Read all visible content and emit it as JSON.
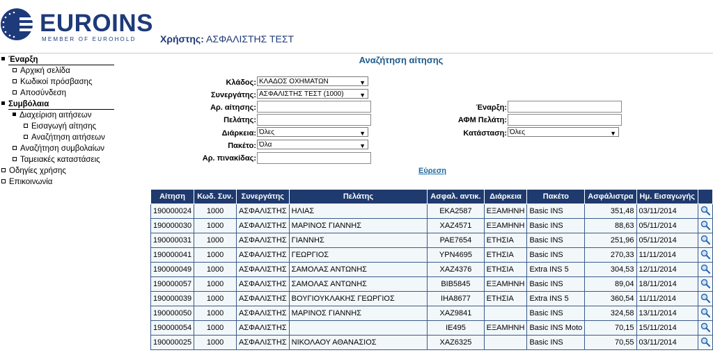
{
  "header": {
    "brand": "EUROINS",
    "brand_sub": "MEMBER OF EUROHOLD",
    "user_label": "Χρήστης:",
    "user_name": "ΑΣΦΑΛΙΣΤΗΣ ΤΕΣΤ"
  },
  "sidebar": {
    "items": [
      {
        "label": "Έναρξη"
      },
      {
        "label": "Αρχική σελίδα"
      },
      {
        "label": "Κωδικοί πρόσβασης"
      },
      {
        "label": "Αποσύνδεση"
      },
      {
        "label": "Συμβόλαια"
      },
      {
        "label": "Διαχείριση αιτήσεων"
      },
      {
        "label": "Εισαγωγή αίτησης"
      },
      {
        "label": "Αναζήτηση αιτήσεων"
      },
      {
        "label": "Αναζήτηση συμβολαίων"
      },
      {
        "label": "Ταμειακές καταστάσεις"
      },
      {
        "label": "Οδηγίες χρήσης"
      },
      {
        "label": "Επικοινωνία"
      }
    ]
  },
  "main": {
    "title": "Αναζήτηση αίτησης",
    "form": {
      "branch_label": "Κλάδος:",
      "branch_value": "ΚΛΑΔΟΣ ΟΧΗΜΑΤΩΝ",
      "partner_label": "Συνεργάτης:",
      "partner_value": "ΑΣΦΑΛΙΣΤΗΣ ΤΕΣΤ (1000)",
      "app_no_label": "Αρ. αίτησης:",
      "client_label": "Πελάτης:",
      "duration_label": "Διάρκεια:",
      "duration_value": "Όλες",
      "package_label": "Πακέτο:",
      "package_value": "Όλα",
      "plate_label": "Αρ. πινακίδας:",
      "start_label": "Έναρξη:",
      "afm_label": "ΑΦΜ Πελάτη:",
      "status_label": "Κατάσταση:",
      "status_value": "Όλες",
      "search_label": "Εύρεση"
    },
    "table": {
      "headers": [
        "Αίτηση",
        "Κωδ. Συν.",
        "Συνεργάτης",
        "Πελάτης",
        "Ασφαλ. αντικ.",
        "Διάρκεια",
        "Πακέτο",
        "Ασφάλιστρα",
        "Ημ. Εισαγωγής"
      ],
      "rows": [
        [
          "190000024",
          "1000",
          "ΑΣΦΑΛΙΣΤΗΣ",
          "ΗΛΙΑΣ",
          "ΕΚΑ2587",
          "ΕΞΑΜΗΝΗ",
          "Basic INS",
          "351,48",
          "03/11/2014"
        ],
        [
          "190000030",
          "1000",
          "ΑΣΦΑΛΙΣΤΗΣ",
          "ΜΑΡΙΝΟΣ ΓΙΑΝΝΗΣ",
          "ΧΑΖ4571",
          "ΕΞΑΜΗΝΗ",
          "Basic INS",
          "88,63",
          "05/11/2014"
        ],
        [
          "190000031",
          "1000",
          "ΑΣΦΑΛΙΣΤΗΣ",
          "ΓΙΑΝΝΗΣ",
          "ΡΑΕ7654",
          "ΕΤΗΣΙΑ",
          "Basic INS",
          "251,96",
          "05/11/2014"
        ],
        [
          "190000041",
          "1000",
          "ΑΣΦΑΛΙΣΤΗΣ",
          "ΓΕΩΡΓΙΟΣ",
          "ΥΡΝ4695",
          "ΕΤΗΣΙΑ",
          "Basic INS",
          "270,33",
          "11/11/2014"
        ],
        [
          "190000049",
          "1000",
          "ΑΣΦΑΛΙΣΤΗΣ",
          "ΣΑΜΟΛΑΣ ΑΝΤΩΝΗΣ",
          "ΧΑΖ4376",
          "ΕΤΗΣΙΑ",
          "Extra INS 5",
          "304,53",
          "12/11/2014"
        ],
        [
          "190000057",
          "1000",
          "ΑΣΦΑΛΙΣΤΗΣ",
          "ΣΑΜΟΛΑΣ ΑΝΤΩΝΗΣ",
          "ΒΙΒ5845",
          "ΕΞΑΜΗΝΗ",
          "Basic INS",
          "89,04",
          "18/11/2014"
        ],
        [
          "190000039",
          "1000",
          "ΑΣΦΑΛΙΣΤΗΣ",
          "ΒΟΥΓΙΟΥΚΛΑΚΗΣ ΓΕΩΡΓΙΟΣ",
          "ΙΗΑ8677",
          "ΕΤΗΣΙΑ",
          "Extra INS 5",
          "360,54",
          "11/11/2014"
        ],
        [
          "190000050",
          "1000",
          "ΑΣΦΑΛΙΣΤΗΣ",
          "ΜΑΡΙΝΟΣ ΓΙΑΝΝΗΣ",
          "ΧΑΖ9841",
          "",
          "Basic INS",
          "324,58",
          "13/11/2014"
        ],
        [
          "190000054",
          "1000",
          "ΑΣΦΑΛΙΣΤΗΣ",
          "",
          "ΙΕ495",
          "ΕΞΑΜΗΝΗ",
          "Basic INS Moto",
          "70,15",
          "15/11/2014"
        ],
        [
          "190000025",
          "1000",
          "ΑΣΦΑΛΙΣΤΗΣ",
          "ΝΙΚΟΛΑΟΥ ΑΘΑΝΑΣΙΟΣ",
          "ΧΑΖ6325",
          "",
          "Basic INS",
          "70,55",
          "03/11/2014"
        ]
      ]
    }
  }
}
